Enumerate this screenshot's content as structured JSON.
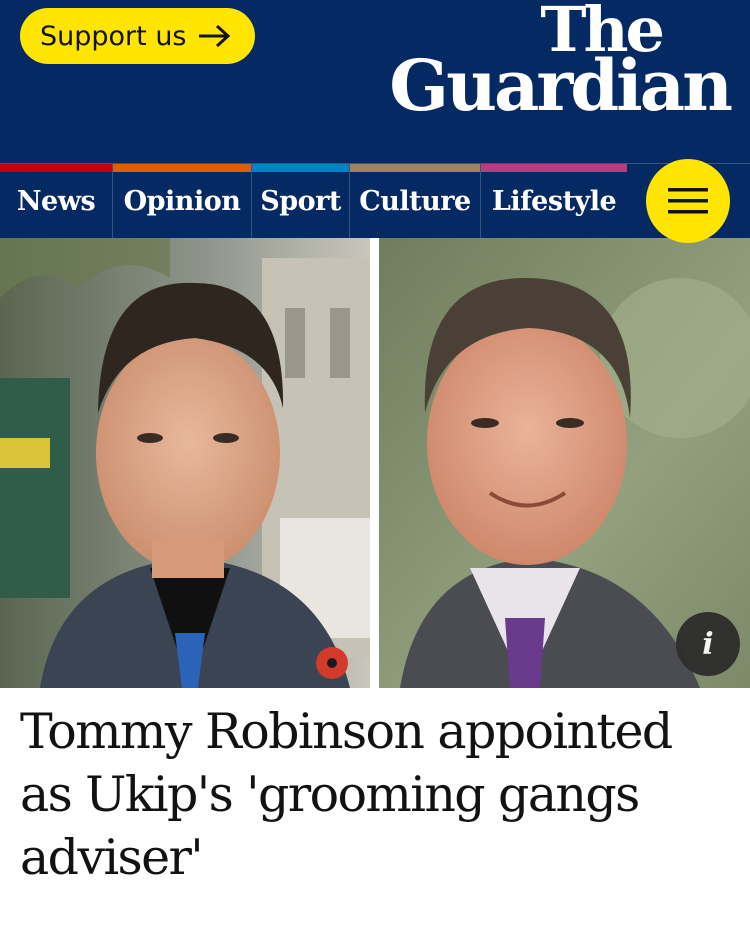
{
  "header": {
    "support_label": "Support us",
    "logo_line1": "The",
    "logo_line2": "Guardian"
  },
  "nav": {
    "items": [
      {
        "label": "News",
        "color": "#c70000"
      },
      {
        "label": "Opinion",
        "color": "#e05e00"
      },
      {
        "label": "Sport",
        "color": "#0084c6"
      },
      {
        "label": "Culture",
        "color": "#a1845c"
      },
      {
        "label": "Lifestyle",
        "color": "#bb3b80"
      }
    ]
  },
  "article": {
    "headline": "Tommy Robinson appointed as Ukip's 'grooming gangs adviser'"
  },
  "image": {
    "info_label": "i"
  },
  "colors": {
    "brand_navy": "#052962",
    "accent_yellow": "#ffe500"
  }
}
